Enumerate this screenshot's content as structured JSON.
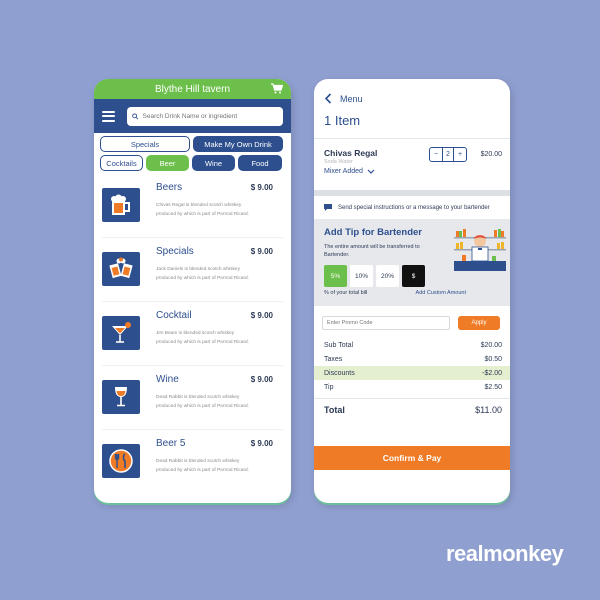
{
  "menu_screen": {
    "title": "Blythe Hill tavern",
    "search_placeholder": "Search Drink Name or ingredient",
    "categories_row1": [
      "Specials",
      "Make My Own Drink"
    ],
    "categories_row2": [
      "Cocktails",
      "Beer",
      "Wine",
      "Food"
    ],
    "active_category": "Beer",
    "items": [
      {
        "name": "Beers",
        "price": "$ 9.00",
        "desc_line1": "Chivas Regal is blended scotch whiskey",
        "desc_line2": "produced by which is part of Pernod Ricard.",
        "icon": "beer-mug-icon"
      },
      {
        "name": "Specials",
        "price": "$ 9.00",
        "desc_line1": "Jack Daniels is blended scotch whiskey",
        "desc_line2": "produced by which is part of Pernod Ricard.",
        "icon": "cheers-icon"
      },
      {
        "name": "Cocktail",
        "price": "$ 9.00",
        "desc_line1": "Jim Beam is blended scotch whiskey",
        "desc_line2": "produced by which is part of Pernod Ricard.",
        "icon": "cocktail-glass-icon"
      },
      {
        "name": "Wine",
        "price": "$ 9.00",
        "desc_line1": "Dead Rabbit is blended scotch whiskey",
        "desc_line2": "produced by which is part of Pernod Ricard.",
        "icon": "wine-glass-icon"
      },
      {
        "name": "Beer 5",
        "price": "$ 9.00",
        "desc_line1": "Dead Rabbit is blended scotch whiskey",
        "desc_line2": "produced by which is part of Pernod Ricard.",
        "icon": "plate-cutlery-icon"
      }
    ]
  },
  "cart_screen": {
    "back_label": "Menu",
    "item_count": "1 Item",
    "order": {
      "name": "Chivas Regal",
      "subtitle": "Soda Water",
      "mixer_label": "Mixer Added",
      "quantity": "2",
      "minus": "−",
      "plus": "+",
      "price": "$20.00"
    },
    "instructions_label": "Send special instructions or a message to your bartender",
    "tip": {
      "title": "Add Tip for Bartender",
      "description": "The entire amount will be transferred to Bartender.",
      "options": [
        "5%",
        "10%",
        "20%",
        "$"
      ],
      "selected": "5%",
      "footer_left": "% of your total bill",
      "footer_right": "Add Custom Amount"
    },
    "promo_placeholder": "Enter Promo Code",
    "apply_label": "Apply",
    "totals": [
      {
        "label": "Sub Total",
        "value": "$20.00"
      },
      {
        "label": "Taxes",
        "value": "$0.50"
      },
      {
        "label": "Discounts",
        "value": "-$2.00"
      },
      {
        "label": "Tip",
        "value": "$2.50"
      }
    ],
    "total_label": "Total",
    "total_value": "$11.00",
    "confirm_label": "Confirm & Pay"
  },
  "brand": "realmonkey",
  "colors": {
    "background": "#8f9fd0",
    "navy": "#2d4f8e",
    "green": "#6cbf4a",
    "orange": "#f07b26"
  }
}
